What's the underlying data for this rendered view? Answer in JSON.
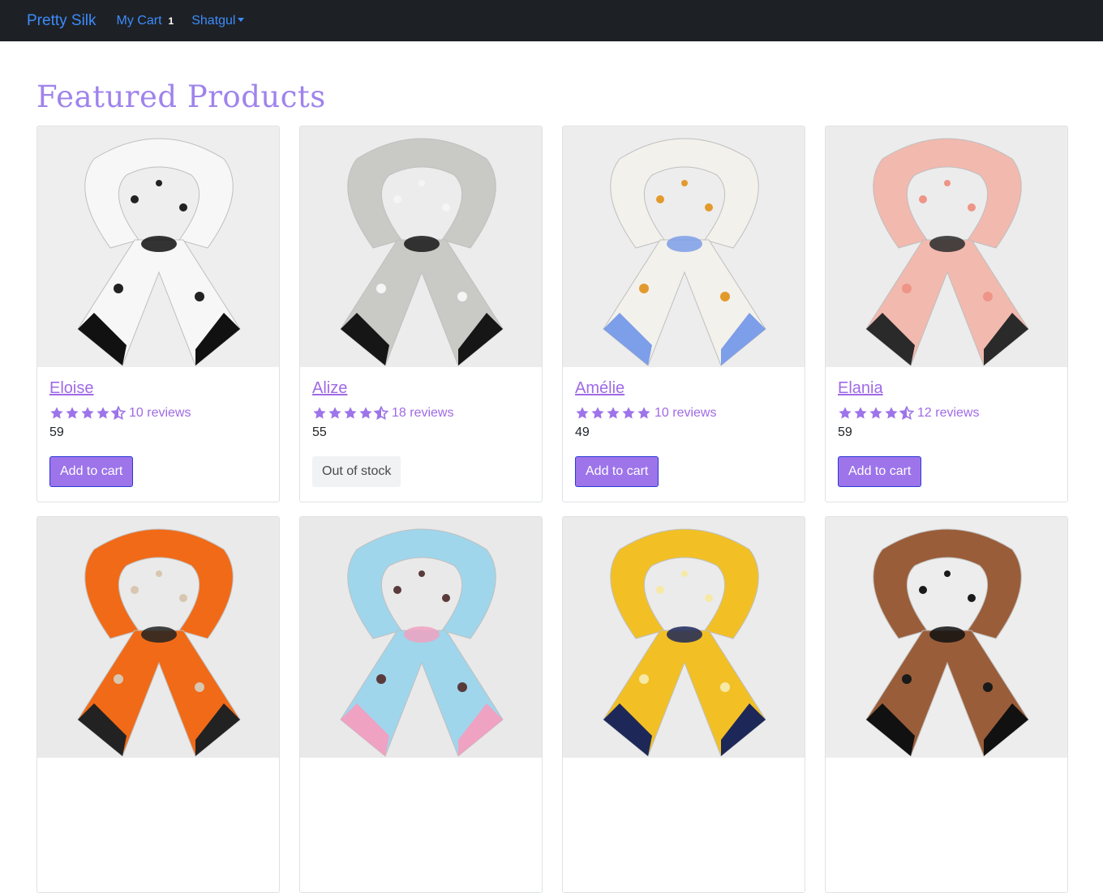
{
  "navbar": {
    "brand": "Pretty Silk",
    "cart_label": "My Cart",
    "cart_count": "1",
    "user_label": "Shatgul"
  },
  "page": {
    "title": "Featured Products"
  },
  "products": [
    {
      "name": "Eloise",
      "rating": 4.5,
      "reviews": "10 reviews",
      "price": "59",
      "action": "Add to cart",
      "in_stock": true,
      "colors": {
        "bg": "#eeeeee",
        "main": "#f7f7f7",
        "trim": "#111111",
        "pattern": "#222222"
      }
    },
    {
      "name": "Alize",
      "rating": 4.5,
      "reviews": "18 reviews",
      "price": "55",
      "action": "Out of stock",
      "in_stock": false,
      "colors": {
        "bg": "#ececec",
        "main": "#c9cac6",
        "trim": "#161616",
        "pattern": "#f5f5f5"
      }
    },
    {
      "name": "Amélie",
      "rating": 5,
      "reviews": "10 reviews",
      "price": "49",
      "action": "Add to cart",
      "in_stock": true,
      "colors": {
        "bg": "#ededed",
        "main": "#f3f1ec",
        "trim": "#7d9ee8",
        "pattern": "#e29a2d"
      }
    },
    {
      "name": "Elania",
      "rating": 4.5,
      "reviews": "12 reviews",
      "price": "59",
      "action": "Add to cart",
      "in_stock": true,
      "colors": {
        "bg": "#ececec",
        "main": "#f2b9af",
        "trim": "#2a2a2a",
        "pattern": "#ee9587"
      }
    },
    {
      "name": "",
      "colors": {
        "bg": "#eaeaea",
        "main": "#f16a17",
        "trim": "#222222",
        "pattern": "#d8c6b0"
      }
    },
    {
      "name": "",
      "colors": {
        "bg": "#e9e9e9",
        "main": "#9fd6ec",
        "trim": "#efa2c2",
        "pattern": "#5a3b3b"
      }
    },
    {
      "name": "",
      "colors": {
        "bg": "#ebebeb",
        "main": "#f2c025",
        "trim": "#1d2859",
        "pattern": "#f6e9a6"
      }
    },
    {
      "name": "",
      "colors": {
        "bg": "#ededed",
        "main": "#9a5d39",
        "trim": "#111111",
        "pattern": "#1a1a1a"
      }
    }
  ]
}
